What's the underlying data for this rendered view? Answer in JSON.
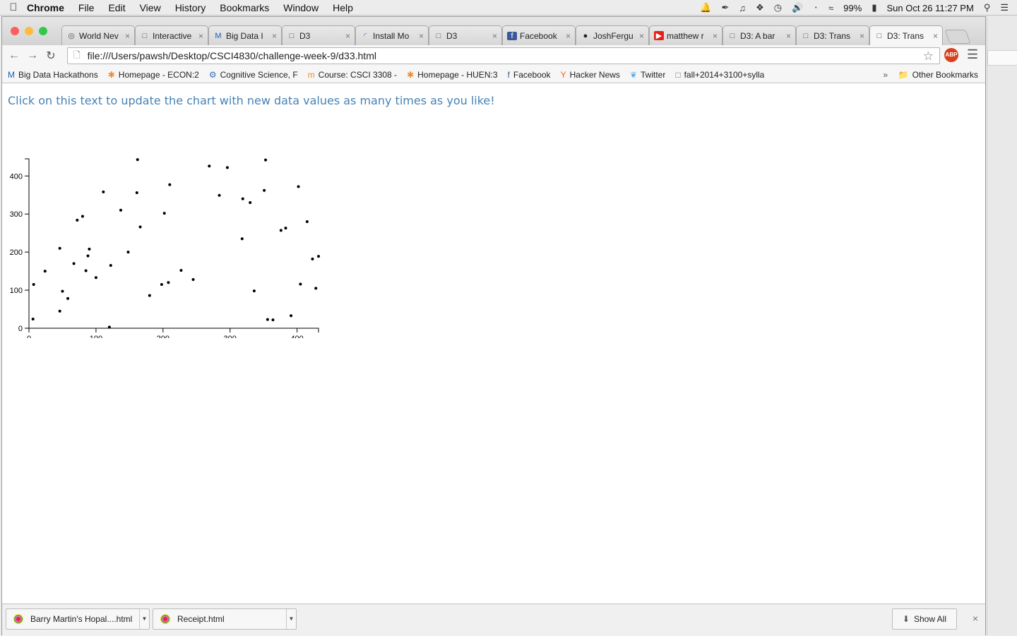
{
  "menubar": {
    "app_name": "Chrome",
    "items": [
      "File",
      "Edit",
      "View",
      "History",
      "Bookmarks",
      "Window",
      "Help"
    ],
    "battery": "99%",
    "clock": "Sun Oct 26  11:27 PM"
  },
  "tabs": [
    {
      "title": "World Nev",
      "icon": "globe-icon"
    },
    {
      "title": "Interactive",
      "icon": "page-icon"
    },
    {
      "title": "Big Data I",
      "icon": "gmail-icon"
    },
    {
      "title": "D3",
      "icon": "page-icon"
    },
    {
      "title": "Install Mo",
      "icon": "spinner-icon"
    },
    {
      "title": "D3",
      "icon": "page-icon"
    },
    {
      "title": "Facebook",
      "icon": "facebook-icon"
    },
    {
      "title": "JoshFergu",
      "icon": "github-icon"
    },
    {
      "title": "matthew r",
      "icon": "youtube-icon"
    },
    {
      "title": "D3: A bar",
      "icon": "page-icon"
    },
    {
      "title": "D3: Trans",
      "icon": "page-icon"
    },
    {
      "title": "D3: Trans",
      "icon": "page-icon",
      "active": true
    }
  ],
  "address": {
    "url": "file:///Users/pawsh/Desktop/CSCI4830/challenge-week-9/d33.html",
    "extension_label": "ABP"
  },
  "bookmarks": {
    "items": [
      {
        "label": "Big Data Hackathons",
        "icon": "gmail-icon"
      },
      {
        "label": "Homepage - ECON:2",
        "icon": "asterisk-icon"
      },
      {
        "label": "Cognitive Science, F",
        "icon": "gear-icon"
      },
      {
        "label": "Course: CSCI 3308 -",
        "icon": "moodle-icon"
      },
      {
        "label": "Homepage - HUEN:3",
        "icon": "asterisk-icon"
      },
      {
        "label": "Facebook",
        "icon": "facebook-icon"
      },
      {
        "label": "Hacker News",
        "icon": "ycombinator-icon"
      },
      {
        "label": "Twitter",
        "icon": "twitter-icon"
      },
      {
        "label": "fall+2014+3100+sylla",
        "icon": "page-icon"
      }
    ],
    "more": "»",
    "other": "Other Bookmarks"
  },
  "page": {
    "prompt": "Click on this text to update the chart with new data values as many times as you like!"
  },
  "chart_data": {
    "type": "scatter",
    "title": "",
    "xlabel": "",
    "ylabel": "",
    "xlim": [
      0,
      432
    ],
    "ylim": [
      0,
      445
    ],
    "xticks": [
      0,
      100,
      200,
      300,
      400
    ],
    "yticks": [
      0,
      100,
      200,
      300,
      400
    ],
    "points": [
      [
        6,
        24
      ],
      [
        7,
        115
      ],
      [
        24,
        150
      ],
      [
        46,
        210
      ],
      [
        46,
        45
      ],
      [
        50,
        97
      ],
      [
        58,
        78
      ],
      [
        67,
        170
      ],
      [
        72,
        284
      ],
      [
        80,
        294
      ],
      [
        85,
        151
      ],
      [
        88,
        190
      ],
      [
        90,
        208
      ],
      [
        100,
        133
      ],
      [
        111,
        358
      ],
      [
        120,
        3
      ],
      [
        122,
        165
      ],
      [
        137,
        310
      ],
      [
        148,
        200
      ],
      [
        161,
        356
      ],
      [
        162,
        443
      ],
      [
        166,
        266
      ],
      [
        180,
        86
      ],
      [
        198,
        115
      ],
      [
        202,
        302
      ],
      [
        208,
        120
      ],
      [
        210,
        377
      ],
      [
        227,
        152
      ],
      [
        245,
        128
      ],
      [
        269,
        426
      ],
      [
        284,
        349
      ],
      [
        296,
        422
      ],
      [
        318,
        235
      ],
      [
        319,
        340
      ],
      [
        330,
        330
      ],
      [
        336,
        98
      ],
      [
        351,
        362
      ],
      [
        353,
        442
      ],
      [
        356,
        23
      ],
      [
        364,
        22
      ],
      [
        376,
        257
      ],
      [
        383,
        263
      ],
      [
        391,
        33
      ],
      [
        402,
        372
      ],
      [
        405,
        116
      ],
      [
        415,
        280
      ],
      [
        423,
        182
      ],
      [
        428,
        105
      ],
      [
        432,
        189
      ]
    ]
  },
  "downloads": {
    "items": [
      {
        "name": "Barry Martin's Hopal....html",
        "icon": "chrome-file-icon"
      },
      {
        "name": "Receipt.html",
        "icon": "chrome-file-icon"
      }
    ],
    "show_all": "Show All",
    "close": "×"
  }
}
